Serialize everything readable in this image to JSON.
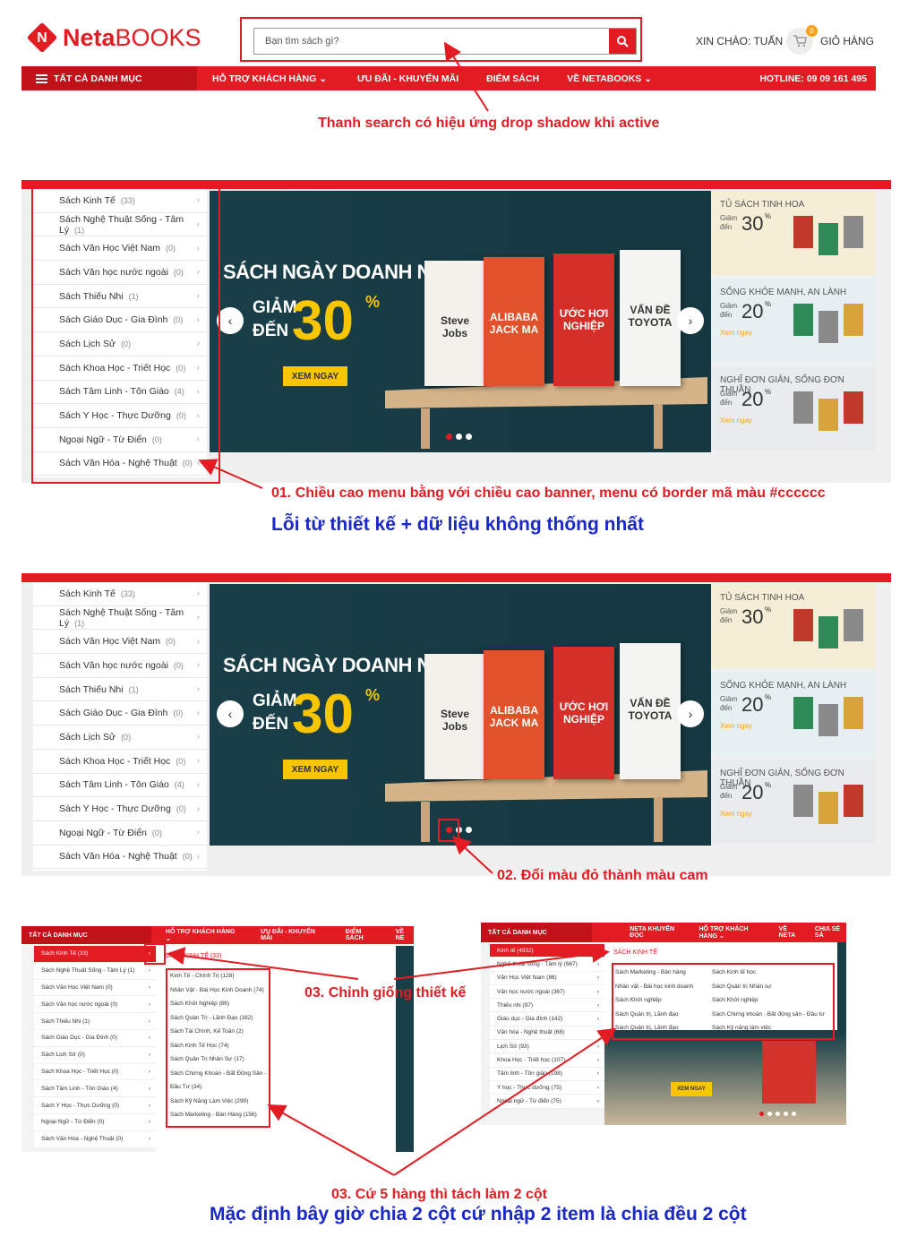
{
  "header": {
    "logo_brand": "Neta",
    "logo_suffix": "BOOKS",
    "search_placeholder": "Bạn tìm sách gì?",
    "greeting": "XIN CHÀO: TUẤN",
    "cart_label": "GIỎ HÀNG",
    "cart_count": "0"
  },
  "navbar": {
    "all_categories": "TẤT CẢ DANH MỤC",
    "items": [
      "HỖ TRỢ KHÁCH HÀNG ⌄",
      "ƯU ĐÃI - KHUYẾN MÃI",
      "ĐIỂM SÁCH",
      "VỀ NETABOOKS ⌄"
    ],
    "hotline": "HOTLINE: 09 09 161 495"
  },
  "notes": {
    "search_note": "Thanh search có hiệu ứng drop shadow khi active",
    "note_01": "01. Chiều cao menu bằng với chiều cao banner, menu có border mã màu #cccccc",
    "note_error": "Lỗi từ thiết kế + dữ liệu không thống nhất",
    "note_02": "02. Đổi màu đỏ thành màu cam",
    "note_03a": "03. Chỉnh giống thiết kế",
    "note_03b": "03. Cứ 5 hàng thì tách làm 2 cột",
    "note_default": "Mặc định bây giờ chia 2 cột cứ nhập 2 item là chia đều 2 cột"
  },
  "categories": [
    {
      "name": "Sách Kinh Tế",
      "count": "(33)"
    },
    {
      "name": "Sách Nghệ Thuật Sống - Tâm Lý",
      "count": "(1)"
    },
    {
      "name": "Sách Văn Học Việt Nam",
      "count": "(0)"
    },
    {
      "name": "Sách Văn học nước ngoài",
      "count": "(0)"
    },
    {
      "name": "Sách Thiếu Nhi",
      "count": "(1)"
    },
    {
      "name": "Sách Giáo Dục - Gia Đình",
      "count": "(0)"
    },
    {
      "name": "Sách Lịch Sử",
      "count": "(0)"
    },
    {
      "name": "Sách Khoa Học - Triết Học",
      "count": "(0)"
    },
    {
      "name": "Sách Tâm Linh - Tôn Giáo",
      "count": "(4)"
    },
    {
      "name": "Sách Y Học - Thực Dưỡng",
      "count": "(0)"
    },
    {
      "name": "Ngoại Ngữ - Từ Điển",
      "count": "(0)"
    },
    {
      "name": "Sách Văn Hóa - Nghệ Thuật",
      "count": "(0)"
    }
  ],
  "banner": {
    "title": "SÁCH NGÀY DOANH NHÂN",
    "discount_word": "GIẢM ĐẾN",
    "discount_value": "30",
    "percent": "%",
    "cta": "XEM NGAY",
    "books": [
      "Steve Jobs",
      "ALIBABA JACK MA",
      "ƯỚC HƠI NGHIỆP",
      "VẤN ĐỀ TOYOTA"
    ]
  },
  "side_cards": [
    {
      "title": "TỦ SÁCH TINH HOA",
      "giam": "Giảm đến",
      "value": "30",
      "link": ""
    },
    {
      "title": "SỐNG KHỎE MẠNH, AN LÀNH",
      "giam": "Giảm đến",
      "value": "20",
      "link": "Xem ngay"
    },
    {
      "title": "NGHĨ ĐƠN GIẢN, SỐNG ĐƠN THUẦN",
      "giam": "Giảm đến",
      "value": "20",
      "link": "Xem ngay"
    }
  ],
  "mini_left": {
    "nav": [
      "TẤT CẢ DANH MỤC",
      "HỖ TRỢ KHÁCH HÀNG ⌄",
      "ƯU ĐÃI - KHUYẾN MÃI",
      "ĐIỂM SÁCH",
      "VỀ NE"
    ],
    "categories": [
      "Sách Kinh Tế (33)",
      "Sách Nghệ Thuật Sống - Tâm Lý (1)",
      "Sách Văn Học Việt Nam (0)",
      "Sách Văn học nước ngoài (0)",
      "Sách Thiếu Nhi (1)",
      "Sách Giáo Dục - Gia Đình (0)",
      "Sách Lịch Sử (0)",
      "Sách Khoa Học - Triết Học (0)",
      "Sách Tâm Linh - Tôn Giáo (4)",
      "Sách Y Học - Thực Dưỡng (0)",
      "Ngoại Ngữ - Từ Điển (0)",
      "Sách Văn Hóa - Nghệ Thuật (0)"
    ],
    "sub_title": "SÁCH KINH TẾ (33)",
    "sub_items": [
      "Kinh Tế - Chính Trị (128)",
      "Nhân Vật - Bài Học Kinh Doanh (74)",
      "Sách Khởi Nghiệp (86)",
      "Sách Quản Trị - Lãnh Đạo (162)",
      "Sách Tài Chính, Kế Toán (2)",
      "Sách Kinh Tế Học (74)",
      "Sách Quản Trị Nhân Sự (17)",
      "Sách Chứng Khoán - Bất Động Sản -",
      "Đầu Tư (34)",
      "Sách Kỹ Năng Làm Việc (299)",
      "Sách Marketing - Bán Hàng (156)"
    ]
  },
  "mini_right": {
    "nav": [
      "TẤT CẢ DANH MỤC",
      "NETA KHUYẾN ĐỌC",
      "HỖ TRỢ KHÁCH HÀNG ⌄",
      "VỀ NETA",
      "CHIA SẺ SÁ"
    ],
    "categories": [
      "Kinh tế (4932)",
      "Nghệ thuật sống - Tâm lý (667)",
      "Văn Học Việt Nam (86)",
      "Văn học nước ngoài (367)",
      "Thiếu nhi (97)",
      "Giáo dục - Gia đình (142)",
      "Văn hóa - Nghệ thuật (68)",
      "Lịch Sử (93)",
      "Khoa Học - Triết học (107)",
      "Tâm linh - Tôn giáo (198)",
      "Y học - Thực dưỡng (75)",
      "Ngoại ngữ - Từ điển (75)"
    ],
    "sub_title": "SÁCH KINH TẾ",
    "col1": [
      "Sách Marketing - Bán hàng",
      "Nhân vật - Bài học kinh doanh",
      "Sách Khởi nghiệp",
      "Sách Quản trị, Lãnh đạo",
      "Sách Quản trị, Lãnh đạo"
    ],
    "col2": [
      "Sách Kinh tế học",
      "Sách Quản trị Nhân sự",
      "Sách Khởi nghiệp",
      "Sách Chứng khoán - Bất động sản - Đầu tư",
      "Sách Kỹ năng làm việc"
    ],
    "cta": "XEM NGAY"
  }
}
